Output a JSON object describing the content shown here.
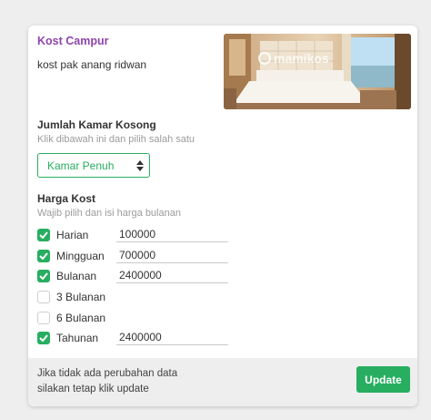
{
  "kost": {
    "type": "Kost Campur",
    "name": "kost pak anang ridwan",
    "photo_watermark": "mamikos"
  },
  "rooms": {
    "title": "Jumlah Kamar Kosong",
    "subtitle": "Klik dibawah ini dan pilih salah satu",
    "selected": "Kamar Penuh"
  },
  "prices": {
    "title": "Harga Kost",
    "subtitle": "Wajib pilih dan isi harga bulanan",
    "items": [
      {
        "label": "Harian",
        "checked": true,
        "value": "100000"
      },
      {
        "label": "Mingguan",
        "checked": true,
        "value": "700000"
      },
      {
        "label": "Bulanan",
        "checked": true,
        "value": "2400000"
      },
      {
        "label": "3 Bulanan",
        "checked": false,
        "value": ""
      },
      {
        "label": "6 Bulanan",
        "checked": false,
        "value": ""
      },
      {
        "label": "Tahunan",
        "checked": true,
        "value": "2400000"
      }
    ]
  },
  "footer": {
    "note_line1": "Jika tidak ada perubahan data",
    "note_line2": "silakan tetap klik update",
    "update_label": "Update"
  },
  "colors": {
    "accent_green": "#27ae60",
    "title_purple": "#8e44ad",
    "footer_bg": "#eeeeee"
  }
}
